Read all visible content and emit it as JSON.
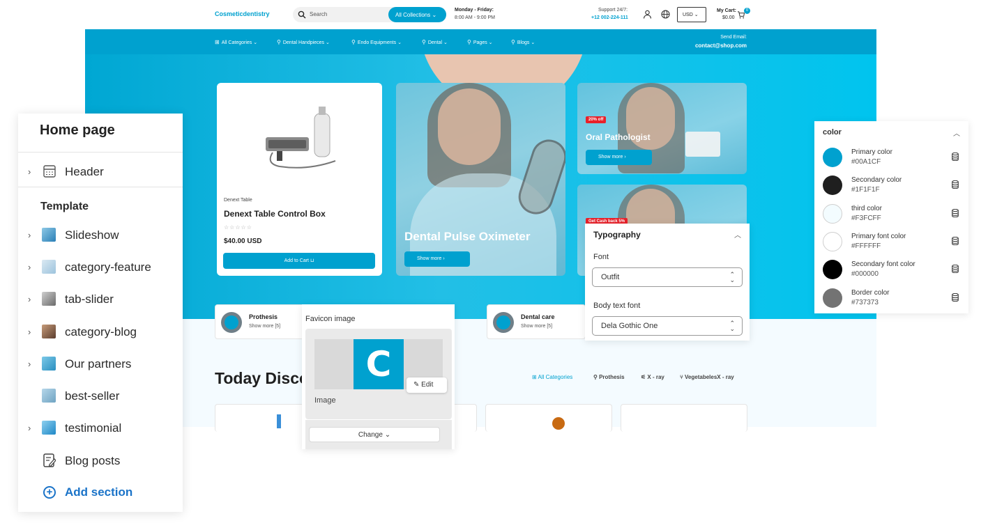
{
  "store": {
    "logo": "Cosmeticdentistry",
    "search_placeholder": "Search",
    "all_collections": "All Collections",
    "hours_title": "Monday - Friday:",
    "hours_time": "8:00 AM - 9:00 PM",
    "support_label": "Support 24/7:",
    "support_phone": "+12 002-224-111",
    "currency": "USD",
    "cart_label": "My Cart:",
    "cart_total": "$0.00",
    "cart_count": "0",
    "nav": [
      {
        "label": "All Categories"
      },
      {
        "label": "Dental Handpieces"
      },
      {
        "label": "Endo Equipments"
      },
      {
        "label": "Dental"
      },
      {
        "label": "Pages"
      },
      {
        "label": "Blogs"
      }
    ],
    "send_email_label": "Send Email:",
    "send_email": "contact@shop.com",
    "product": {
      "brand": "Denext Table",
      "title": "Denext Table Control Box",
      "stars": "☆☆☆☆☆",
      "price": "$40.00 USD",
      "add_to_cart": "Add to Cart"
    },
    "banner_main": {
      "title": "Dental Pulse Oximeter",
      "button": "Show more"
    },
    "banner_top": {
      "tag": "20% off",
      "title": "Oral Pathologist",
      "button": "Show more"
    },
    "banner_bottom": {
      "tag": "Get Cash back 5%"
    },
    "categories": [
      {
        "name": "Prothesis",
        "more": "Show more [5]"
      },
      {
        "name": "Dental care",
        "more": "Show more [5]"
      }
    ],
    "today_title": "Today Disco",
    "tabs": [
      "All Categories",
      "Prothesis",
      "X - ray",
      "VegetabelesX - ray"
    ]
  },
  "sidebar": {
    "title": "Home page",
    "header_item": "Header",
    "template_label": "Template",
    "items": [
      {
        "label": "Slideshow",
        "icon": "slideshow-thumb",
        "expandable": true
      },
      {
        "label": "category-feature",
        "icon": "category-feature-thumb",
        "expandable": true
      },
      {
        "label": "tab-slider",
        "icon": "tab-slider-thumb",
        "expandable": true
      },
      {
        "label": "category-blog",
        "icon": "category-blog-thumb",
        "expandable": true
      },
      {
        "label": "Our partners",
        "icon": "partners-thumb",
        "expandable": true
      },
      {
        "label": "best-seller",
        "icon": "best-seller-thumb",
        "expandable": false
      },
      {
        "label": "testimonial",
        "icon": "testimonial-thumb",
        "expandable": true
      },
      {
        "label": "Blog posts",
        "icon": "blog-posts-icon",
        "expandable": false
      }
    ],
    "add_section": "Add section"
  },
  "favicon": {
    "title": "Favicon image",
    "logo_letter": "C",
    "edit": "Edit",
    "image_label": "Image",
    "change": "Change"
  },
  "typography": {
    "title": "Typography",
    "font_label": "Font",
    "font_value": "Outfit",
    "body_label": "Body text font",
    "body_value": "Dela Gothic One"
  },
  "colors": {
    "title": "color",
    "items": [
      {
        "name": "Primary color",
        "hex": "#00A1CF"
      },
      {
        "name": "Secondary color",
        "hex": "#1F1F1F"
      },
      {
        "name": "third color",
        "hex": "#F3FCFF"
      },
      {
        "name": "Primary font color",
        "hex": "#FFFFFF"
      },
      {
        "name": "Secondary font color",
        "hex": "#000000"
      },
      {
        "name": "Border color",
        "hex": "#737373"
      }
    ]
  }
}
